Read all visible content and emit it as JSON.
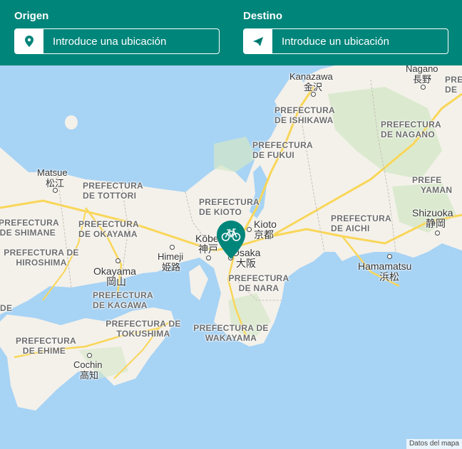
{
  "origin": {
    "label": "Origen",
    "placeholder": "Introduce una ubicación",
    "icon": "map-pin-icon"
  },
  "destination": {
    "label": "Destino",
    "placeholder": "Introduce un ubicación",
    "icon": "paper-plane-icon"
  },
  "colors": {
    "header": "#00857a",
    "water": "#a7d3f5",
    "land": "#f4f1ea",
    "forest": "#d4e8c8",
    "highway": "#f9d658",
    "marker": "#00857a"
  },
  "map": {
    "marker_icon": "bicycle-icon",
    "prefectures": [
      "PREFECTURA DE ISHIKAWA",
      "PREFECTURA DE NAGANO",
      "PREFECTURA DE FUKUI",
      "PREFECTURA DE TOTTORI",
      "PREFECTURA DE KIOTO",
      "PREFECTURA DE SHIMANE",
      "PREFECTURA DE OKAYAMA",
      "PREFECTURA DE HIROSHIMA",
      "PREFECTURA DE AICHI",
      "PREFECTURA DE NARA",
      "PREFECTURA DE KAGAWA",
      "PREFECTURA DE TOKUSHIMA",
      "PREFECTURA DE WAKAYAMA",
      "PREFECTURA DE EHIME"
    ],
    "cities": {
      "kanazawa": "Kanazawa",
      "kanazawa_jp": "金沢",
      "nagano": "Nagano",
      "nagano_jp": "長野",
      "matsue": "Matsue",
      "matsue_jp": "松江",
      "kobe": "Kōbe",
      "kobe_jp": "神戸",
      "kyoto": "Kioto",
      "kyoto_jp": "京都",
      "osaka": "Osaka",
      "osaka_jp": "大阪",
      "himeji": "Himeji",
      "himeji_jp": "姫路",
      "okayama": "Okayama",
      "okayama_jp": "岡山",
      "shizuoka": "Shizuoka",
      "shizuoka_jp": "静岡",
      "hamamatsu": "Hamamatsu",
      "hamamatsu_jp": "浜松",
      "kochi": "Cochin",
      "kochi_jp": "高知"
    },
    "edge_labels": {
      "top_right_1": "PRE",
      "top_right_2": "DE",
      "yamana_1": "PREFE",
      "yamana_2": "YAMAN",
      "left_de": "DE",
      "shimane_pre": "PREFECTURA"
    },
    "attribution": "Datos del mapa"
  }
}
